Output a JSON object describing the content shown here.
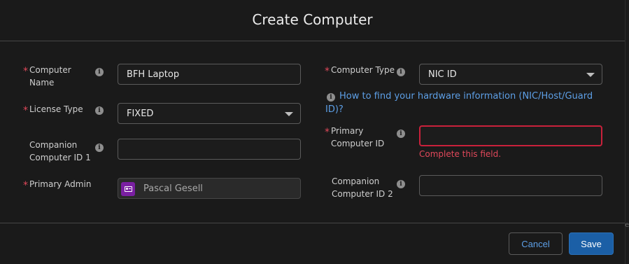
{
  "modal": {
    "title": "Create Computer"
  },
  "form": {
    "computer_name": {
      "label_line1": "Computer",
      "label_line2": "Name",
      "value": "BFH Laptop",
      "required": "*"
    },
    "license_type": {
      "label": "License Type",
      "value": "FIXED",
      "required": "*"
    },
    "companion_1": {
      "label_line1": "Companion",
      "label_line2": "Computer ID 1",
      "value": ""
    },
    "primary_admin": {
      "label": "Primary Admin",
      "value": "Pascal Gesell",
      "required": "*"
    },
    "computer_type": {
      "label": "Computer Type",
      "value": "NIC ID",
      "required": "*"
    },
    "help_link": {
      "line1": "How to find your hardware information (NIC/Host/Guard",
      "line2": "ID)?"
    },
    "primary_computer_id": {
      "label_line1": "Primary",
      "label_line2": "Computer ID",
      "value": "",
      "required": "*",
      "error": "Complete this field."
    },
    "companion_2": {
      "label_line1": "Companion",
      "label_line2": "Computer ID 2",
      "value": ""
    }
  },
  "footer": {
    "cancel_label": "Cancel",
    "save_label": "Save"
  },
  "edge_text": "e",
  "colors": {
    "background": "#1a1a1a",
    "required": "#e0485a",
    "link": "#5d9fe6",
    "primary_button": "#1b5fa6",
    "error_border": "#c9213b",
    "avatar": "#7a1fa2"
  }
}
